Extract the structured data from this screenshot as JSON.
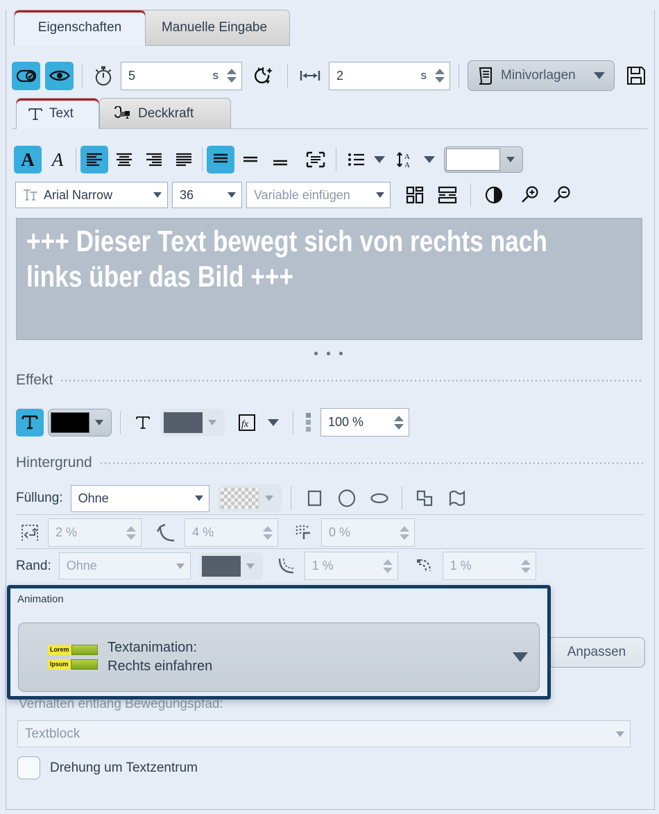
{
  "window": {
    "title": "Eigenschaften"
  },
  "tabs": [
    {
      "label": "Eigenschaften",
      "active": true
    },
    {
      "label": "Manuelle Eingabe",
      "active": false
    }
  ],
  "toolbar": {
    "toggle_selectable": "selectable-toggle-icon",
    "toggle_visible": "eye-icon",
    "duration_icon": "stopwatch-icon",
    "duration_value": "5",
    "duration_unit": "s",
    "keyframe_icon": "timer-effect-icon",
    "transition_icon": "width-arrows-icon",
    "transition_value": "2",
    "transition_unit": "s",
    "minitemplates_label": "Minivorlagen",
    "minitemplates_icon": "template-list-icon",
    "save_icon": "floppy-disk-icon"
  },
  "subtabs": [
    {
      "label": "Text",
      "icon": "text-T-icon",
      "active": true
    },
    {
      "label": "Deckkraft",
      "icon": "opacity-icon",
      "active": false
    }
  ],
  "format_toolbar": {
    "bold_label": "A",
    "italic_label": "A",
    "align_left": "align-left-icon",
    "align_center": "align-center-icon",
    "align_right": "align-right-icon",
    "align_justify": "align-justify-icon",
    "valign_top": "valign-top-icon",
    "valign_middle": "valign-middle-icon",
    "valign_bottom": "valign-bottom-icon",
    "autofit": "fit-text-icon",
    "bullets": "bullet-list-icon",
    "linespacing": "line-spacing-icon",
    "color_value": "#ffffff"
  },
  "font_row": {
    "font_icon": "font-TT-icon",
    "font_family": "Arial Narrow",
    "font_size": "36",
    "variable_placeholder": "Variable einfügen",
    "distribute_h_icon": "distribute-horizontal-icon",
    "distribute_v_icon": "distribute-vertical-icon",
    "contrast_icon": "contrast-icon",
    "zoom_in_icon": "zoom-in-icon",
    "zoom_out_icon": "zoom-out-icon"
  },
  "preview": {
    "lines": [
      "+++ Dieser Text bewegt sich von rechts nach",
      "links über das Bild +++"
    ],
    "text_color": "#ffffff",
    "bg_color": "#b4bfcb",
    "overflow_indicator": "• • •"
  },
  "effect": {
    "title": "Effekt",
    "fill_icon": "text-fill-T-icon",
    "fill_color": "#000000",
    "outline_icon": "text-outline-T-icon",
    "outline_color": "#555f6b",
    "fx_icon": "fx-icon",
    "opacity_value": "100 %"
  },
  "background": {
    "title": "Hintergrund",
    "fill_label": "Füllung:",
    "fill_value": "Ohne",
    "fill_swatch": "transparent-checker",
    "shape_rect_icon": "rectangle-icon",
    "shape_circle_icon": "circle-icon",
    "shape_ellipse_icon": "ellipse-icon",
    "shape_merge_icon": "merge-shapes-icon",
    "shape_custom_icon": "custom-shape-icon",
    "padding_icon": "padding-icon",
    "padding_value": "2 %",
    "corner_icon": "corner-radius-icon",
    "corner_value": "4 %",
    "shadow_icon": "shadow-icon",
    "shadow_value": "0 %",
    "border_label": "Rand:",
    "border_value": "Ohne",
    "border_color": "#555f6b",
    "border_width_icon": "border-width-icon",
    "border_width_value": "1 %",
    "border_radius_icon": "border-radius-icon",
    "border_radius_value": "1 %"
  },
  "animation": {
    "title": "Animation",
    "thumb_label_1": "Lorem",
    "thumb_label_2": "Ipsum",
    "selected_line1": "Textanimation:",
    "selected_line2": "Rechts einfahren",
    "adjust_button": "Anpassen",
    "behavior_label": "Verhalten entlang Bewegungspfad:",
    "behavior_value": "Textblock",
    "rotate_checkbox_label": "Drehung um Textzentrum",
    "rotate_checked": false,
    "highlight_color": "#123d66"
  },
  "colors": {
    "accent": "#39aedd",
    "tab_accent": "#b01c20",
    "panel_bg": "#e6edf6",
    "highlight": "#123d66"
  }
}
